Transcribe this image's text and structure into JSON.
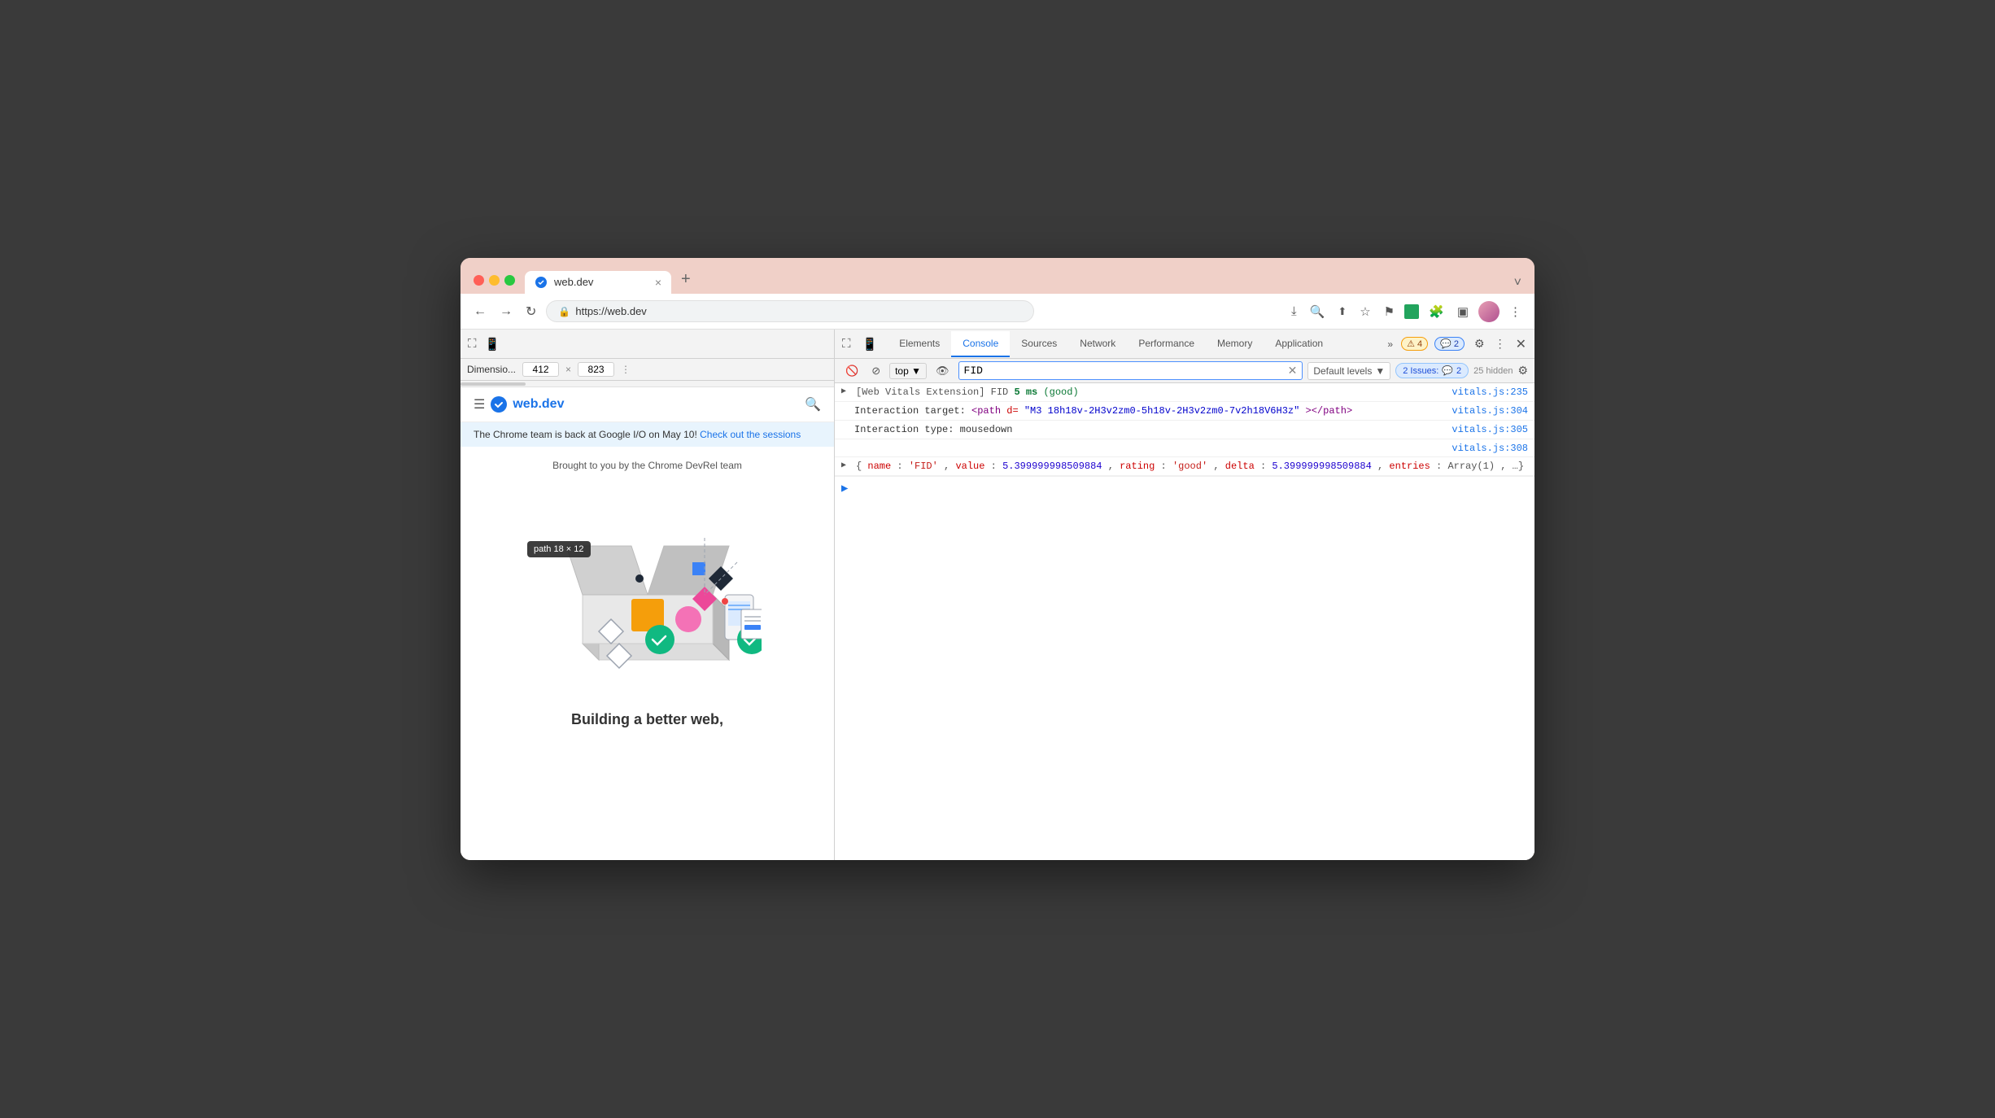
{
  "browser": {
    "title": "web.dev",
    "url": "https://web.dev",
    "tab_label": "web.dev",
    "tab_close": "×",
    "new_tab": "+",
    "tab_menu": "˅"
  },
  "nav": {
    "back": "←",
    "forward": "→",
    "refresh": "↻",
    "secure_icon": "🔒"
  },
  "toolbar_icons": {
    "download": "⤓",
    "zoom": "🔍",
    "share": "⬆",
    "star": "☆",
    "flag": "⚑",
    "green_square": "■",
    "puzzle": "⚙",
    "sidebar": "▣",
    "menu": "⋮"
  },
  "dimensions": {
    "preset": "Dimensio...",
    "width": "412",
    "height": "823",
    "separator": "×",
    "more": "⋮"
  },
  "devtools": {
    "tabs": [
      {
        "label": "Elements",
        "active": false
      },
      {
        "label": "Console",
        "active": true
      },
      {
        "label": "Sources",
        "active": false
      },
      {
        "label": "Network",
        "active": false
      },
      {
        "label": "Performance",
        "active": false
      },
      {
        "label": "Memory",
        "active": false
      },
      {
        "label": "Application",
        "active": false
      }
    ],
    "more_tabs": "»",
    "badge_warning": "⚠ 4",
    "badge_chat": "💬 2",
    "settings_icon": "⚙",
    "kebab": "⋮",
    "close": "×"
  },
  "console_toolbar": {
    "clear_icon": "🚫",
    "filter_icon": "⊘",
    "context": "top",
    "context_arrow": "▼",
    "eye_icon": "👁",
    "input_placeholder": "FID",
    "input_value": "FID",
    "clear_input": "×",
    "levels": "Default levels",
    "levels_arrow": "▼",
    "issues_label": "2 Issues:",
    "issues_count": "2",
    "hidden_count": "25 hidden",
    "gear_icon": "⚙"
  },
  "console_entries": [
    {
      "id": 1,
      "expandable": true,
      "prefix": "[Web Vitals Extension] FID",
      "metric_value": "5 ms",
      "metric_rating": "(good)",
      "file": "vitals.js:235",
      "type": "log"
    },
    {
      "id": 2,
      "expandable": false,
      "indent": true,
      "label": "Interaction target:",
      "code": "<path d=\"M3 18h18v-2H3v2zm0-5h18v-2H3v2zm0-7v2h18V6H3z\"></path>",
      "file": "vitals.js:304",
      "type": "log"
    },
    {
      "id": 3,
      "expandable": false,
      "indent": true,
      "label": "Interaction type:",
      "value": "mousedown",
      "file": "vitals.js:305",
      "type": "log"
    },
    {
      "id": 4,
      "expandable": false,
      "indent": false,
      "spacer": true,
      "file": "vitals.js:308",
      "type": "log"
    },
    {
      "id": 5,
      "expandable": true,
      "expanded": false,
      "object_content": "{name: 'FID', value: 5.399999998509884, rating: 'good', delta: 5.399999998509884, entries: Array(1), …}",
      "type": "object"
    }
  ],
  "webpage": {
    "logo_text": "web.dev",
    "banner": "The Chrome team is back at Google I/O on May 10!",
    "banner_link_text": "Check out the sessions",
    "tagline": "Building a better web,",
    "brought_by": "Brought to you by the Chrome DevRel team"
  },
  "tooltip": {
    "element": "path",
    "dimensions": "18 × 12"
  }
}
